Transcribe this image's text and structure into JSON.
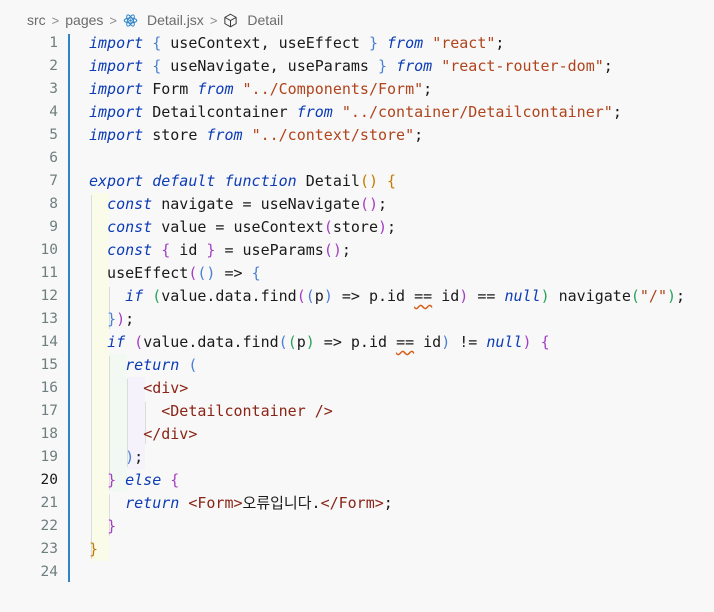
{
  "breadcrumb": {
    "items": [
      "src",
      "pages",
      "Detail.jsx",
      "Detail"
    ]
  },
  "editor": {
    "active_line": 20,
    "line_numbers": [
      "1",
      "2",
      "3",
      "4",
      "5",
      "6",
      "7",
      "8",
      "9",
      "10",
      "11",
      "12",
      "13",
      "14",
      "15",
      "16",
      "17",
      "18",
      "19",
      "20",
      "21",
      "22",
      "23",
      "24"
    ],
    "lines": [
      [
        [
          "kw",
          "import"
        ],
        [
          "id",
          " "
        ],
        [
          "b1",
          "{"
        ],
        [
          "id",
          " useContext, useEffect "
        ],
        [
          "b1",
          "}"
        ],
        [
          "id",
          " "
        ],
        [
          "kw",
          "from"
        ],
        [
          "id",
          " "
        ],
        [
          "str",
          "\"react\""
        ],
        [
          "id",
          ";"
        ]
      ],
      [
        [
          "kw",
          "import"
        ],
        [
          "id",
          " "
        ],
        [
          "b1",
          "{"
        ],
        [
          "id",
          " useNavigate, useParams "
        ],
        [
          "b1",
          "}"
        ],
        [
          "id",
          " "
        ],
        [
          "kw",
          "from"
        ],
        [
          "id",
          " "
        ],
        [
          "str",
          "\"react-router-dom\""
        ],
        [
          "id",
          ";"
        ]
      ],
      [
        [
          "kw",
          "import"
        ],
        [
          "id",
          " Form "
        ],
        [
          "kw",
          "from"
        ],
        [
          "id",
          " "
        ],
        [
          "str",
          "\"../Components/Form\""
        ],
        [
          "id",
          ";"
        ]
      ],
      [
        [
          "kw",
          "import"
        ],
        [
          "id",
          " Detailcontainer "
        ],
        [
          "kw",
          "from"
        ],
        [
          "id",
          " "
        ],
        [
          "str",
          "\"../container/Detailcontainer\""
        ],
        [
          "id",
          ";"
        ]
      ],
      [
        [
          "kw",
          "import"
        ],
        [
          "id",
          " store "
        ],
        [
          "kw",
          "from"
        ],
        [
          "id",
          " "
        ],
        [
          "str",
          "\"../context/store\""
        ],
        [
          "id",
          ";"
        ]
      ],
      [],
      [
        [
          "kw",
          "export default function"
        ],
        [
          "id",
          " Detail"
        ],
        [
          "b2",
          "()"
        ],
        [
          "id",
          " "
        ],
        [
          "b2",
          "{"
        ]
      ],
      [
        [
          "id",
          "  "
        ],
        [
          "kw",
          "const"
        ],
        [
          "id",
          " navigate = useNavigate"
        ],
        [
          "b4",
          "()"
        ],
        [
          "id",
          ";"
        ]
      ],
      [
        [
          "id",
          "  "
        ],
        [
          "kw",
          "const"
        ],
        [
          "id",
          " value = useContext"
        ],
        [
          "b4",
          "("
        ],
        [
          "id",
          "store"
        ],
        [
          "b4",
          ")"
        ],
        [
          "id",
          ";"
        ]
      ],
      [
        [
          "id",
          "  "
        ],
        [
          "kw",
          "const"
        ],
        [
          "id",
          " "
        ],
        [
          "b4",
          "{"
        ],
        [
          "id",
          " id "
        ],
        [
          "b4",
          "}"
        ],
        [
          "id",
          " = useParams"
        ],
        [
          "b4",
          "()"
        ],
        [
          "id",
          ";"
        ]
      ],
      [
        [
          "id",
          "  useEffect"
        ],
        [
          "b4",
          "("
        ],
        [
          "b1",
          "()"
        ],
        [
          "id",
          " => "
        ],
        [
          "b1",
          "{"
        ]
      ],
      [
        [
          "id",
          "    "
        ],
        [
          "kw",
          "if"
        ],
        [
          "id",
          " "
        ],
        [
          "b3",
          "("
        ],
        [
          "id",
          "value.data.find"
        ],
        [
          "b4",
          "("
        ],
        [
          "b1",
          "("
        ],
        [
          "id",
          "p"
        ],
        [
          "b1",
          ")"
        ],
        [
          "id",
          " => p.id "
        ],
        [
          "sq",
          "=="
        ],
        [
          "id",
          " id"
        ],
        [
          "b4",
          ")"
        ],
        [
          "id",
          " == "
        ],
        [
          "kw",
          "null"
        ],
        [
          "b3",
          ")"
        ],
        [
          "id",
          " navigate"
        ],
        [
          "b3",
          "("
        ],
        [
          "str",
          "\"/\""
        ],
        [
          "b3",
          ")"
        ],
        [
          "id",
          ";"
        ]
      ],
      [
        [
          "id",
          "  "
        ],
        [
          "b1",
          "}"
        ],
        [
          "b4",
          ")"
        ],
        [
          "id",
          ";"
        ]
      ],
      [
        [
          "id",
          "  "
        ],
        [
          "kw",
          "if"
        ],
        [
          "id",
          " "
        ],
        [
          "b4",
          "("
        ],
        [
          "id",
          "value.data.find"
        ],
        [
          "b1",
          "("
        ],
        [
          "b3",
          "("
        ],
        [
          "id",
          "p"
        ],
        [
          "b3",
          ")"
        ],
        [
          "id",
          " => p.id "
        ],
        [
          "sq",
          "=="
        ],
        [
          "id",
          " id"
        ],
        [
          "b1",
          ")"
        ],
        [
          "id",
          " != "
        ],
        [
          "kw",
          "null"
        ],
        [
          "b4",
          ")"
        ],
        [
          "id",
          " "
        ],
        [
          "b4",
          "{"
        ]
      ],
      [
        [
          "id",
          "    "
        ],
        [
          "kw",
          "return"
        ],
        [
          "id",
          " "
        ],
        [
          "b1",
          "("
        ]
      ],
      [
        [
          "id",
          "      "
        ],
        [
          "tag",
          "<div>"
        ]
      ],
      [
        [
          "id",
          "        "
        ],
        [
          "tag",
          "<Detailcontainer />"
        ]
      ],
      [
        [
          "id",
          "      "
        ],
        [
          "tag",
          "</div>"
        ]
      ],
      [
        [
          "id",
          "    "
        ],
        [
          "b1",
          ")"
        ],
        [
          "id",
          ";"
        ]
      ],
      [
        [
          "id",
          "  "
        ],
        [
          "b4",
          "}"
        ],
        [
          "id",
          " "
        ],
        [
          "kw",
          "else"
        ],
        [
          "id",
          " "
        ],
        [
          "b4",
          "{"
        ]
      ],
      [
        [
          "id",
          "    "
        ],
        [
          "kw",
          "return"
        ],
        [
          "id",
          " "
        ],
        [
          "tag",
          "<Form>"
        ],
        [
          "id",
          "오류입니다."
        ],
        [
          "tag",
          "</Form>"
        ],
        [
          "id",
          ";"
        ]
      ],
      [
        [
          "id",
          "  "
        ],
        [
          "b4",
          "}"
        ]
      ],
      [
        [
          "b2",
          "}"
        ]
      ],
      []
    ]
  },
  "colors": {
    "accent_bar": "#2f84c7",
    "keyword": "#0b3bb6",
    "string": "#b0441c"
  }
}
